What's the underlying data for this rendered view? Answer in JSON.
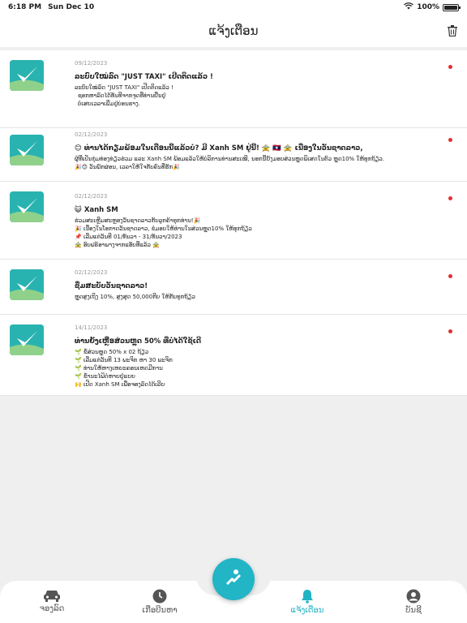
{
  "status": {
    "time": "6:18 PM",
    "date": "Sun Dec 10",
    "battery": "100%"
  },
  "header": {
    "title": "ແຈ້ງເຕືອນ"
  },
  "colors": {
    "accent": "#22b5c6",
    "unread": "#e23030"
  },
  "notifications": [
    {
      "date": "09/12/2023",
      "title": "ລະບົບໃໝ່ລົດ \"JUST TAXI\" ເປີດຕິດແລ້ວ !",
      "lines": [
        "ລະບົບໃໝ່ລົດ \"JUST TAXI\" ເປີດຕິດແລ້ວ !",
        "ຊອກຫາລົດໄດ້ທັນທີຈາກຈຸດທີ່ທ່ານຢືນຢູ່",
        "ບໍ່ເສຍເວລາເພີ່ມຢູ່ບ່ອນຮາງ."
      ]
    },
    {
      "date": "02/12/2023",
      "title": "😊 ທ່ານໄດ້ກຽມພ້ອມໃນເດືອນນີ້ແລ້ວບໍ? ມີ Xanh SM ຢູ່ນີ້! 🚖 🇱🇦 🚖 ເນື່ອງໃນວັນຊາດລາວ,",
      "lines": [
        "ຜູ້ທີ່ເປັນກຸ່ມທ່ອງທ່ຽວຮ່ວມ ແລະ Xanh SM ພ້ອມແລ້ວໃຫ້ບໍລິການທ່ານສະເໝີ, ນອກນີ້ຍັງມອບສ່ວນຫຼຸດພິເສດໃນຕົວ ຫຼຸດ10% ໃຫ້ທຸກຖ້ຽວ.",
        "🎉😊 ວັນພັກຜ່ອນ, ເວລາໃຫ້ໃຈກັບຄົນທີ່ຮັກ🎉"
      ]
    },
    {
      "date": "02/12/2023",
      "title": "😺 Xanh SM",
      "lines": [
        "ຮ່ວມສະເຫຼີມສະຫຼອງວັນຊາດລາວກັບລູກຄ້າທຸກທ່ານ!🎉",
        "🎉 ເນື່ອງໃນໂອກາດວັນຊາດລາວ, ຂໍມອບໃຫ້ທ່ານໃນສ່ວນຫຼຸດ10% ໃຫ້ທຸກຖ້ຽວ",
        "📌 ເລີ່ມແຕ່ວັນທີ 01/ທັນວາ - 31/ທັນວາ/2023",
        "🚖 ອົບຟຣ໌ອາພາງຈາກແອັບທີ່ແລ້ວ 🚖"
      ]
    },
    {
      "date": "02/12/2023",
      "title": "ຊື່ມສະບັບວັນຊາດລາວ!",
      "lines": [
        "ຫຼຸດສູງເຖິງ 10%, ສູງສຸດ 50,000ກີບ ໃຫ້ກັບທຸກຖ້ຽວ"
      ]
    },
    {
      "date": "14/11/2023",
      "title": "ທ່ານຍັງເຫຼືອສ່ວນຫຼຸດ 50% ທີ່ບໍ່ໄດ້ໃຊ້ເດີ",
      "lines": [
        "🌱 ຂໍ້ສ່ວນຫຼຸດ 50% x 02 ຖ້ຽວ",
        "🌱 ເລີ່ມແຕ່ວັນທີ 13 ພະຈິກ ຫາ 30 ພະຈິກ",
        "🌱 ທ່ານໃຫ້ຫາງເຫຍະຄອນເຫດມີການ",
        "🌱 ຂໍ້ານະໄຟ້ດໍຫາຍຢູ່ແຍຍ",
        "🙌 ເປີດ Xanh SM ເພື່ອຈອງລົດໄດ້ເລີຍ"
      ]
    }
  ],
  "tabs": [
    {
      "label": "ຈອງລົດ",
      "icon": "car-icon"
    },
    {
      "label": "ເກືອບີນຫາ",
      "icon": "clock-icon"
    },
    {
      "label": "ແຈ້ງເຕືອນ",
      "icon": "bell-icon"
    },
    {
      "label": "ບັນຊີ",
      "icon": "user-icon"
    }
  ]
}
